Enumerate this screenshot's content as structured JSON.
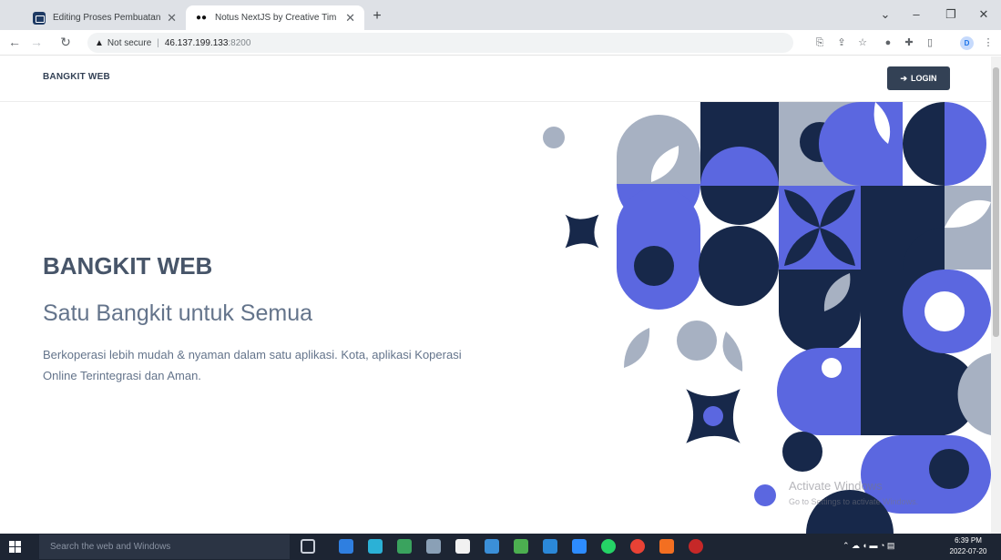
{
  "browser": {
    "tabs": [
      {
        "title": "Editing Proses Pembuatan proje",
        "favicon": "codesandbox-icon",
        "active": false
      },
      {
        "title": "Notus NextJS by Creative Tim",
        "favicon": "creative-tim-icon",
        "active": true
      }
    ],
    "address": {
      "security_label": "Not secure",
      "host": "46.137.199.133",
      "port": ":8200"
    },
    "profile_initial": "D"
  },
  "page": {
    "navbar": {
      "brand": "BANGKIT WEB",
      "login_label": "LOGIN"
    },
    "hero": {
      "title": "BANGKIT WEB",
      "subtitle": "Satu Bangkit untuk Semua",
      "description": "Berkoperasi lebih mudah & nyaman dalam satu aplikasi. Kota, aplikasi Koperasi Online Terintegrasi dan Aman."
    },
    "watermark": {
      "title": "Activate Windows",
      "subtitle": "Go to Settings to activate Windows."
    }
  },
  "taskbar": {
    "search_placeholder": "Search the web and Windows",
    "time": "6:39 PM",
    "date": "2022-07-20"
  },
  "colors": {
    "navy": "#17284a",
    "indigo": "#5b67e0",
    "gray": "#a7b1c2",
    "slate": "#334155"
  }
}
